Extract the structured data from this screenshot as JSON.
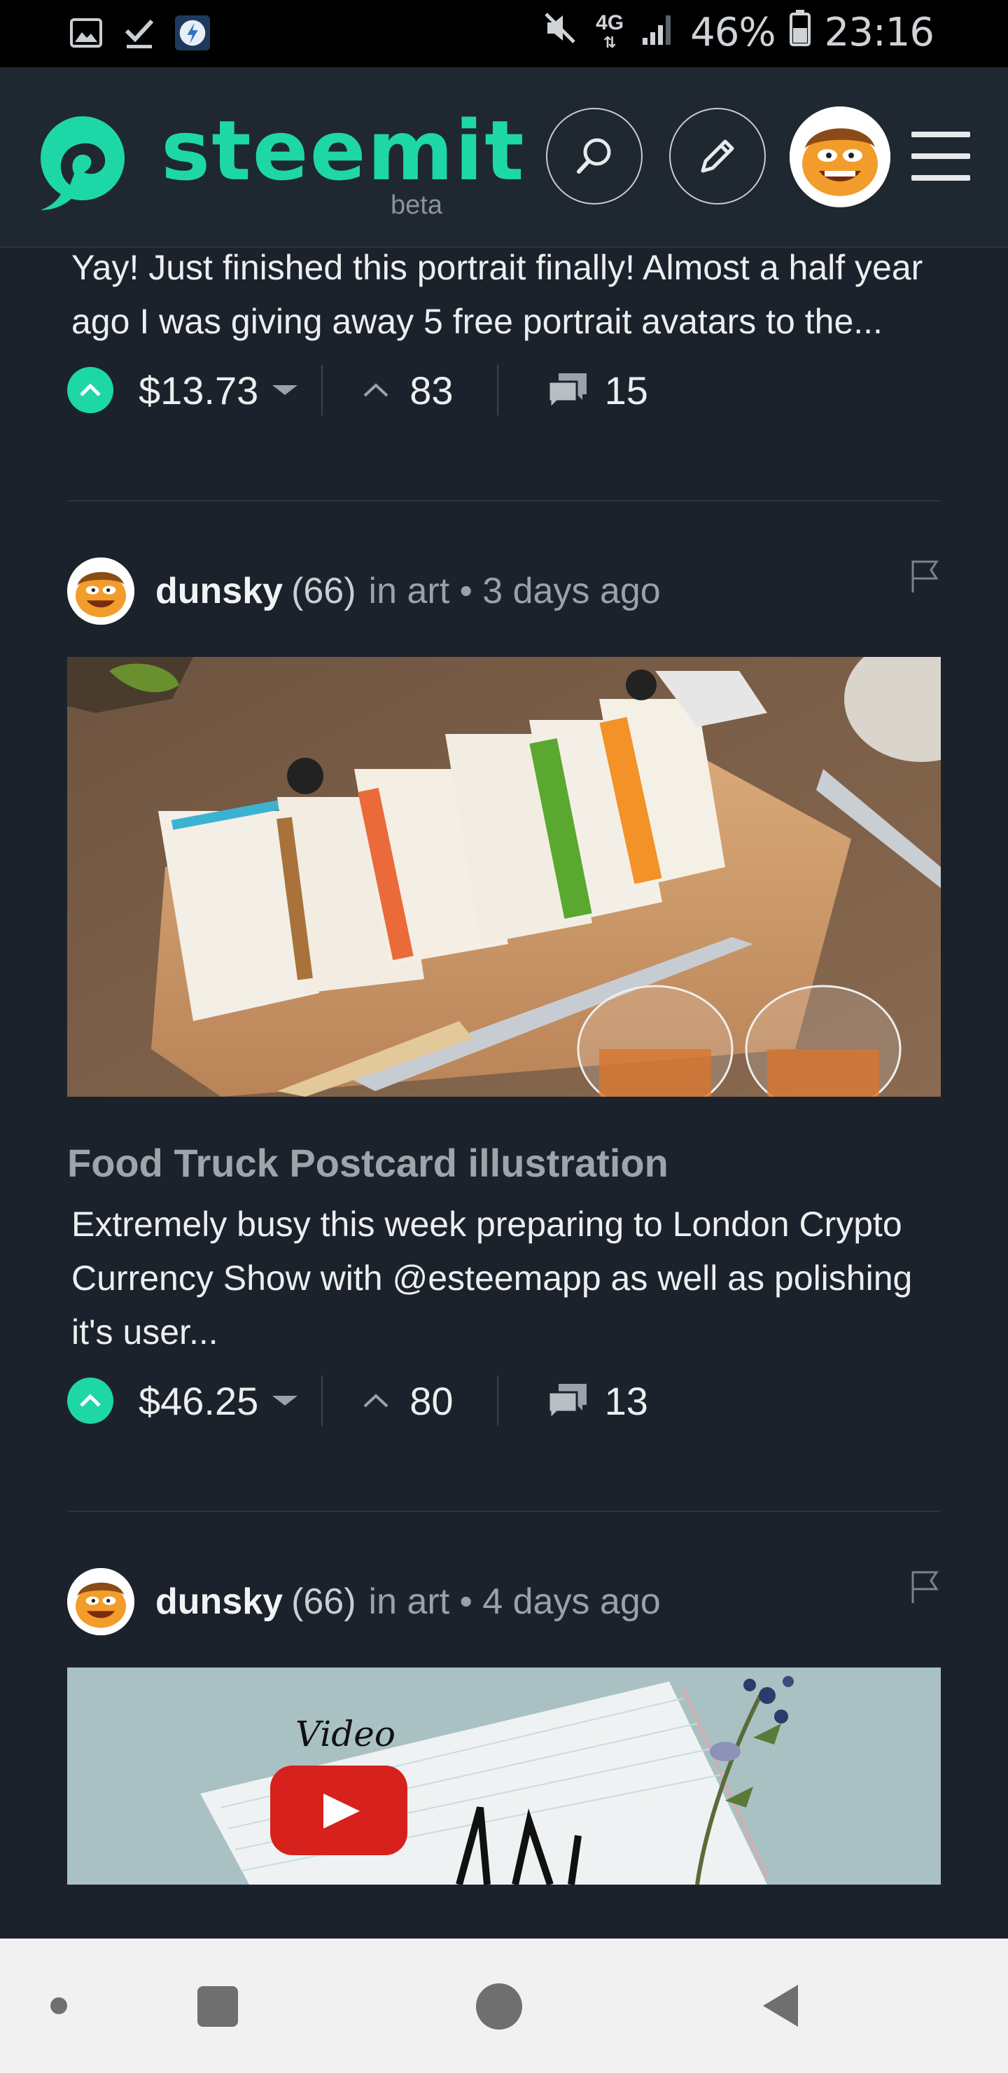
{
  "status_bar": {
    "network": "4G",
    "battery": "46%",
    "time": "23:16"
  },
  "header": {
    "logo_text": "steemit",
    "beta_label": "beta"
  },
  "prev_post": {
    "snippet": "Yay! Just finished this portrait finally! Almost a half year ago I was giving away 5 free portrait avatars to the...",
    "payout": "$13.73",
    "votes": "83",
    "comments": "15"
  },
  "posts": [
    {
      "author": "dunsky",
      "reputation": "(66)",
      "meta": "in art • 3 days ago",
      "title": "Food Truck Postcard illustration",
      "body": "Extremely busy this week preparing to London Crypto Currency Show with @esteemapp as well as polishing it's user...",
      "payout": "$46.25",
      "votes": "80",
      "comments": "13"
    },
    {
      "author": "dunsky",
      "reputation": "(66)",
      "meta": "in art • 4 days ago",
      "image_text": "Video"
    }
  ],
  "colors": {
    "accent": "#1ed7a7",
    "background": "#1c222b",
    "header": "#1f2731"
  },
  "icons": [
    "search-icon",
    "pencil-icon",
    "menu-icon",
    "upvote-icon",
    "chevron-up-icon",
    "comment-icon",
    "flag-icon"
  ]
}
